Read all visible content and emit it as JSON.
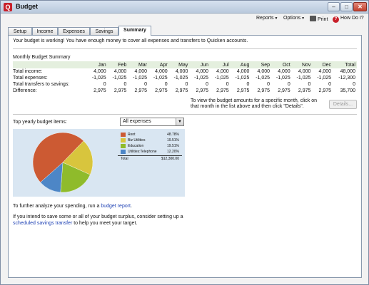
{
  "window": {
    "title": "Budget",
    "app_icon_label": "Q",
    "minimize_glyph": "–",
    "maximize_glyph": "□",
    "close_glyph": "✕"
  },
  "menu": {
    "reports": "Reports",
    "options": "Options",
    "print": "Print",
    "howdoi": "How Do I?"
  },
  "tabs": [
    {
      "label": "Setup"
    },
    {
      "label": "Income"
    },
    {
      "label": "Expenses"
    },
    {
      "label": "Savings"
    },
    {
      "label": "Summary"
    }
  ],
  "status_message": "Your budget is working! You have enough money to cover all expenses and transfers to Quicken accounts.",
  "summary": {
    "title": "Monthly Budget Summary",
    "columns": [
      "Jan",
      "Feb",
      "Mar",
      "Apr",
      "May",
      "Jun",
      "Jul",
      "Aug",
      "Sep",
      "Oct",
      "Nov",
      "Dec",
      "Total"
    ],
    "rows": [
      {
        "label": "Total income:",
        "values": [
          "4,000",
          "4,000",
          "4,000",
          "4,000",
          "4,000",
          "4,000",
          "4,000",
          "4,000",
          "4,000",
          "4,000",
          "4,000",
          "4,000",
          "48,000"
        ]
      },
      {
        "label": "Total expenses:",
        "values": [
          "-1,025",
          "-1,025",
          "-1,025",
          "-1,025",
          "-1,025",
          "-1,025",
          "-1,025",
          "-1,025",
          "-1,025",
          "-1,025",
          "-1,025",
          "-1,025",
          "-12,300"
        ]
      },
      {
        "label": "Total transfers to savings:",
        "values": [
          "0",
          "0",
          "0",
          "0",
          "0",
          "0",
          "0",
          "0",
          "0",
          "0",
          "0",
          "0",
          "0"
        ]
      },
      {
        "label": "Difference:",
        "values": [
          "2,975",
          "2,975",
          "2,975",
          "2,975",
          "2,975",
          "2,975",
          "2,975",
          "2,975",
          "2,975",
          "2,975",
          "2,975",
          "2,975",
          "35,700"
        ]
      }
    ]
  },
  "details": {
    "note": "To view the budget amounts for a specific month, click on that month in the list above and then click \"Details\".",
    "button": "Details..."
  },
  "top_items": {
    "label": "Top yearly budget items:",
    "select_value": "All expenses",
    "select_arrow": "▼"
  },
  "chart_data": {
    "type": "pie",
    "slices": [
      {
        "name": "Rent",
        "pct": 48.78,
        "label": "48.78%",
        "color": "#cc5a33"
      },
      {
        "name": "Biz Utilities",
        "pct": 19.51,
        "label": "19.51%",
        "color": "#d8c53d"
      },
      {
        "name": "Education",
        "pct": 19.51,
        "label": "19.51%",
        "color": "#8fbb2b"
      },
      {
        "name": "Utilities:Telephone",
        "pct": 12.2,
        "label": "12.20%",
        "color": "#4d86c6"
      }
    ],
    "total_label": "Total",
    "total_value": "$12,300.00"
  },
  "analyze": {
    "prefix": "To further analyze your spending, run a ",
    "link": "budget report",
    "suffix": "."
  },
  "surplus": {
    "line1": "If you intend to save some or all of your budget surplus, consider setting up a",
    "link": "scheduled savings transfer",
    "suffix": " to help you meet your target."
  }
}
